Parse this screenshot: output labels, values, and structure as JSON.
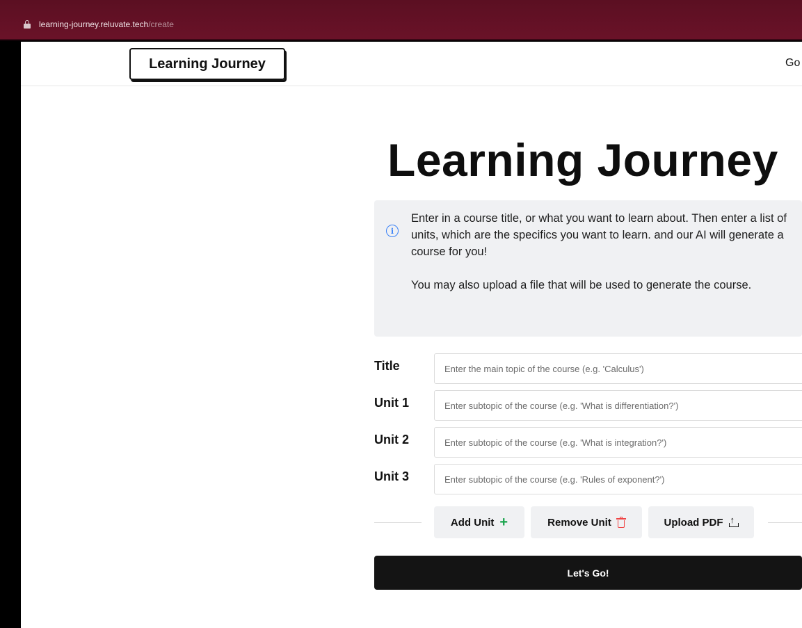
{
  "browser": {
    "url_host": "learning-journey.reluvate.tech",
    "url_path": "/create"
  },
  "navbar": {
    "logo": "Learning Journey",
    "nav_link": "Go"
  },
  "main": {
    "heading": "Learning Journey",
    "info": {
      "paragraph1": "Enter in a course title, or what you want to learn about. Then enter a list of units, which are the specifics you want to learn. and our AI will generate a course for you!",
      "paragraph2": "You may also upload a file that will be used to generate the course."
    },
    "form": {
      "rows": [
        {
          "label": "Title",
          "placeholder": "Enter the main topic of the course (e.g. 'Calculus')"
        },
        {
          "label": "Unit 1",
          "placeholder": "Enter subtopic of the course (e.g. 'What is differentiation?')"
        },
        {
          "label": "Unit 2",
          "placeholder": "Enter subtopic of the course (e.g. 'What is integration?')"
        },
        {
          "label": "Unit 3",
          "placeholder": "Enter subtopic of the course (e.g. 'Rules of exponent?')"
        }
      ]
    },
    "actions": {
      "add_unit": "Add Unit",
      "remove_unit": "Remove Unit",
      "upload_pdf": "Upload PDF"
    },
    "submit": "Let's Go!"
  },
  "icons": {
    "lock": "lock-icon",
    "info": "info-icon",
    "plus": "plus-icon",
    "trash": "trash-icon",
    "upload": "upload-icon"
  },
  "colors": {
    "browser_bar": "#6a1228",
    "info_accent": "#3b82f6",
    "add_accent": "#16a34a",
    "remove_accent": "#ef4444",
    "primary_button": "#141414"
  }
}
